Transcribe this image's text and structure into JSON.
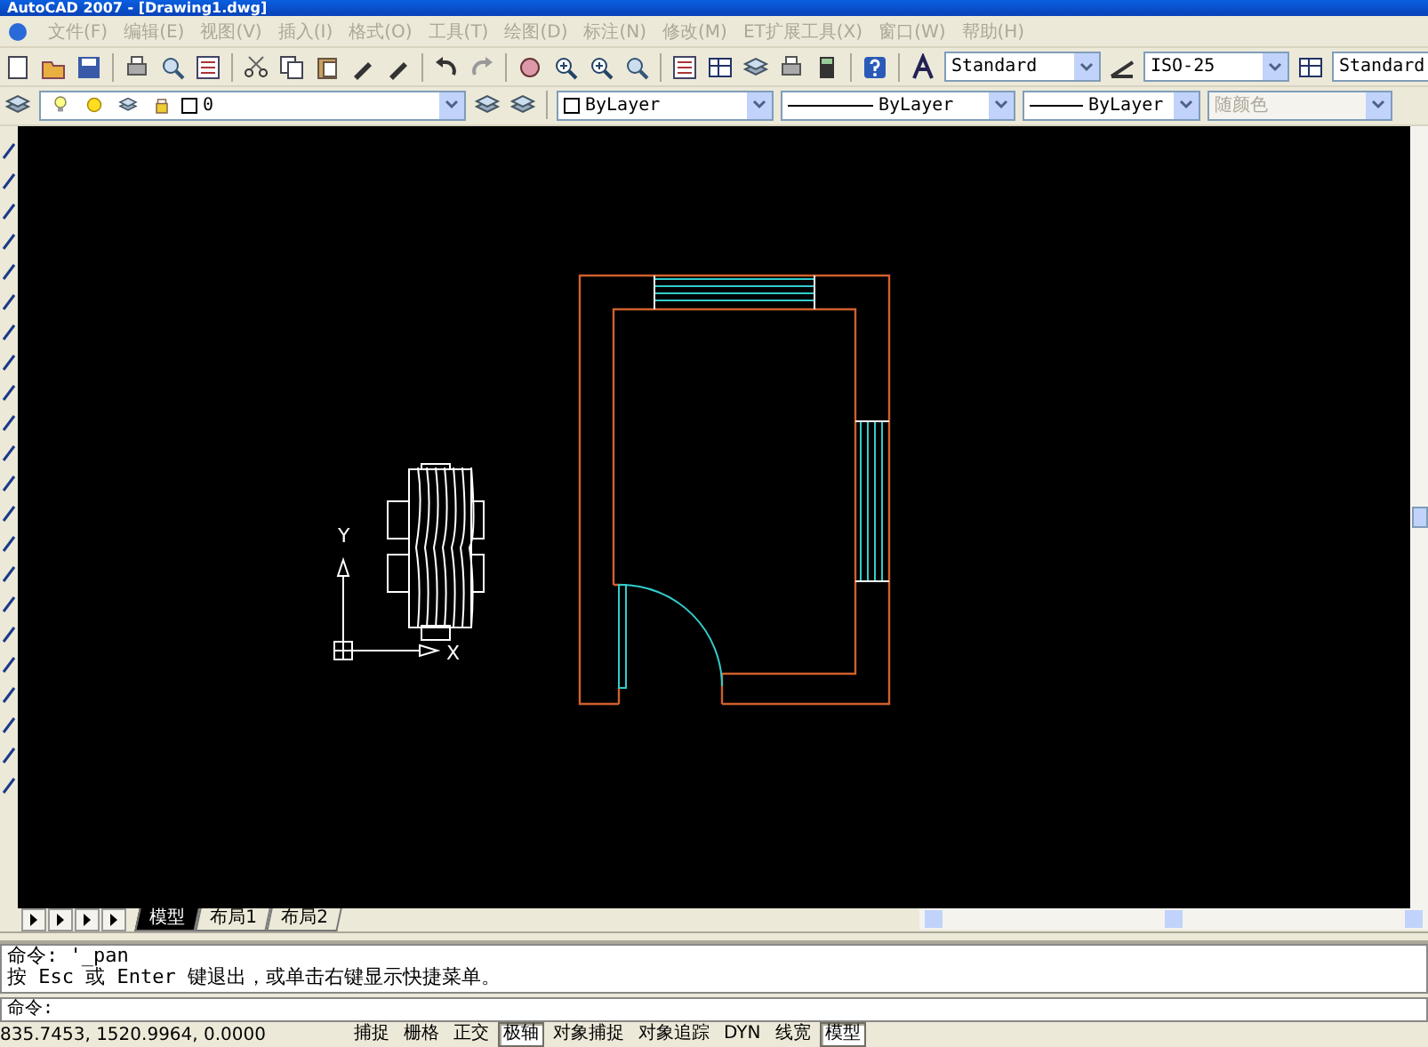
{
  "window": {
    "title": "AutoCAD 2007 - [Drawing1.dwg]"
  },
  "menu": {
    "items": [
      "文件(F)",
      "编辑(E)",
      "视图(V)",
      "插入(I)",
      "格式(O)",
      "工具(T)",
      "绘图(D)",
      "标注(N)",
      "修改(M)",
      "ET扩展工具(X)",
      "窗口(W)",
      "帮助(H)"
    ]
  },
  "styles_toolbar": {
    "text_style": "Standard",
    "dim_style": "ISO-25",
    "table_style": "Standard"
  },
  "layers_toolbar": {
    "layer": "0",
    "color_control": "ByLayer",
    "linetype": "ByLayer",
    "lineweight": "ByLayer",
    "plot_style": {
      "value": "随颜色",
      "disabled": true
    }
  },
  "drawing": {
    "ucs_x": "X",
    "ucs_y": "Y"
  },
  "layout_tabs": [
    {
      "label": "模型",
      "selected": true
    },
    {
      "label": "布局1",
      "selected": false
    },
    {
      "label": "布局2",
      "selected": false
    }
  ],
  "command_history": [
    "命令: '_pan",
    "按 Esc 或 Enter 键退出，或单击右键显示快捷菜单。"
  ],
  "command_prompt": "命令:",
  "status_bar": {
    "coordinates": "835.7453, 1520.9964, 0.0000",
    "toggles": [
      {
        "label": "捕捉",
        "on": false
      },
      {
        "label": "栅格",
        "on": false
      },
      {
        "label": "正交",
        "on": false
      },
      {
        "label": "极轴",
        "on": true
      },
      {
        "label": "对象捕捉",
        "on": false
      },
      {
        "label": "对象追踪",
        "on": false
      },
      {
        "label": "DYN",
        "on": false
      },
      {
        "label": "线宽",
        "on": false
      },
      {
        "label": "模型",
        "on": true
      }
    ]
  }
}
